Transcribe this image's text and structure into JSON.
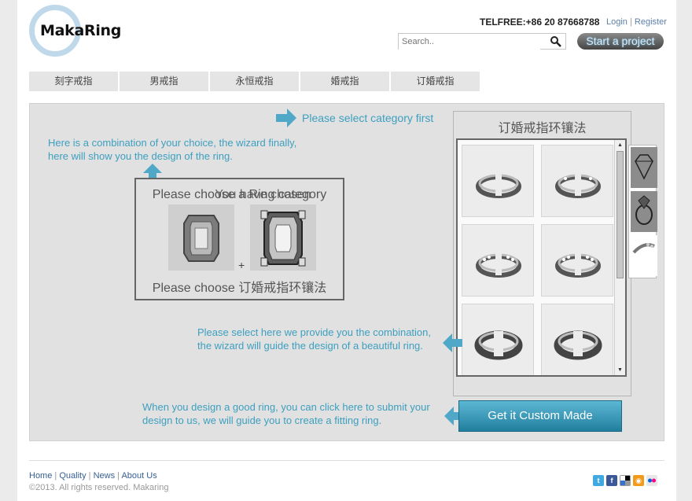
{
  "header": {
    "logo_text": "MakaRing",
    "telfree": "TELFREE:+86 20 87668788",
    "login": "Login",
    "register": "Register",
    "auth_sep": "|",
    "search_placeholder": "Search..",
    "start_project": "Start a project"
  },
  "nav": {
    "tabs": [
      "刻字戒指",
      "男戒指",
      "永恒戒指",
      "婚戒指",
      "订婚戒指"
    ]
  },
  "main": {
    "note_top_right": "Please select category first",
    "note_combination": "Here is a combination of your choice, the wizard finally,\nhere will show you the design of the ring.",
    "combo_title_1": "Please choose a Ring category",
    "combo_title_2": "You have chosen",
    "combo_plus": "+",
    "combo_choose": "Please choose 订婚戒指环镶法",
    "category_title": "订婚戒指环镶法",
    "note_select": "Please select here we provide you the combination,\nthe wizard will guide the design of a beautiful ring.",
    "note_submit": "When you design a good ring, you can click here to submit your\ndesign to us, we will guide you to create a fitting ring.",
    "custom_button": "Get it Custom Made"
  },
  "footer": {
    "links": [
      "Home",
      "Quality",
      "News",
      "About Us"
    ],
    "copyright": "©2013. All rights reserved. Makaring"
  },
  "icons": [
    "search-icon",
    "twitter-icon",
    "facebook-icon",
    "delicious-icon",
    "rss-icon",
    "flickr-icon"
  ],
  "colors": {
    "accent": "#3d9fbf",
    "button_blue": "#217f9e",
    "panel_bg": "#e1e1e1"
  }
}
